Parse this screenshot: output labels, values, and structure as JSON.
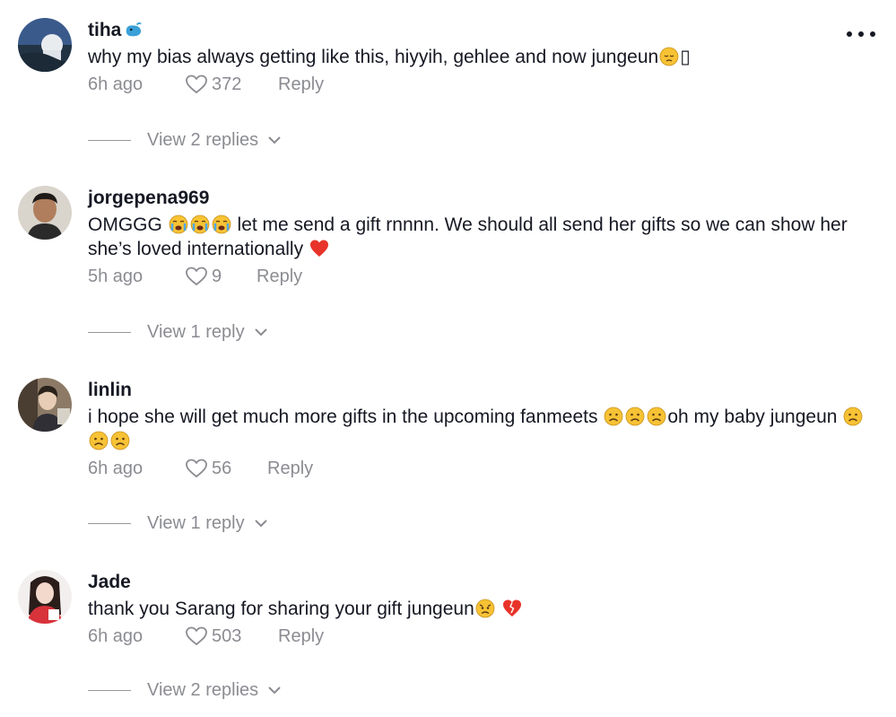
{
  "comments": [
    {
      "username": "tiha",
      "username_emoji": "whale-emoji",
      "text_parts": [
        "why my bias always getting like this, hiyyih, gehlee and now jungeun",
        "▯"
      ],
      "trailing_emoji": "pensive-face-emoji",
      "time": "6h ago",
      "likes": "372",
      "reply_label": "Reply",
      "replies_label": "View 2 replies",
      "avatar": "avatar-landscape"
    },
    {
      "username": "jorgepena969",
      "text_before": "OMGGG",
      "text_after": "let me send a gift rnnnn. We should all send her gifts so we can show her she’s loved internationally",
      "emojis": [
        "loudly-crying-face-emoji",
        "loudly-crying-face-emoji",
        "loudly-crying-face-emoji"
      ],
      "end_emoji": "red-heart-emoji",
      "time": "5h ago",
      "likes": "9",
      "reply_label": "Reply",
      "replies_label": "View 1 reply",
      "avatar": "avatar-person"
    },
    {
      "username": "linlin",
      "text_before": "i hope she will get much more gifts in the upcoming fanmeets",
      "text_mid": "oh my baby jungeun",
      "emojis": [
        "frowning-face-emoji",
        "frowning-face-emoji",
        "frowning-face-emoji"
      ],
      "time": "6h ago",
      "likes": "56",
      "reply_label": "Reply",
      "replies_label": "View 1 reply",
      "avatar": "avatar-room"
    },
    {
      "username": "Jade",
      "text_before": "thank you Sarang for sharing your gift jungeun",
      "emojis": [
        "worried-face-emoji",
        "broken-heart-emoji"
      ],
      "time": "6h ago",
      "likes": "503",
      "reply_label": "Reply",
      "replies_label": "View 2 replies",
      "avatar": "avatar-girl"
    }
  ],
  "colors": {
    "text": "#161823",
    "muted": "#8a8b91",
    "heart_red": "#e8332a",
    "emoji_yellow": "#f7c234"
  }
}
